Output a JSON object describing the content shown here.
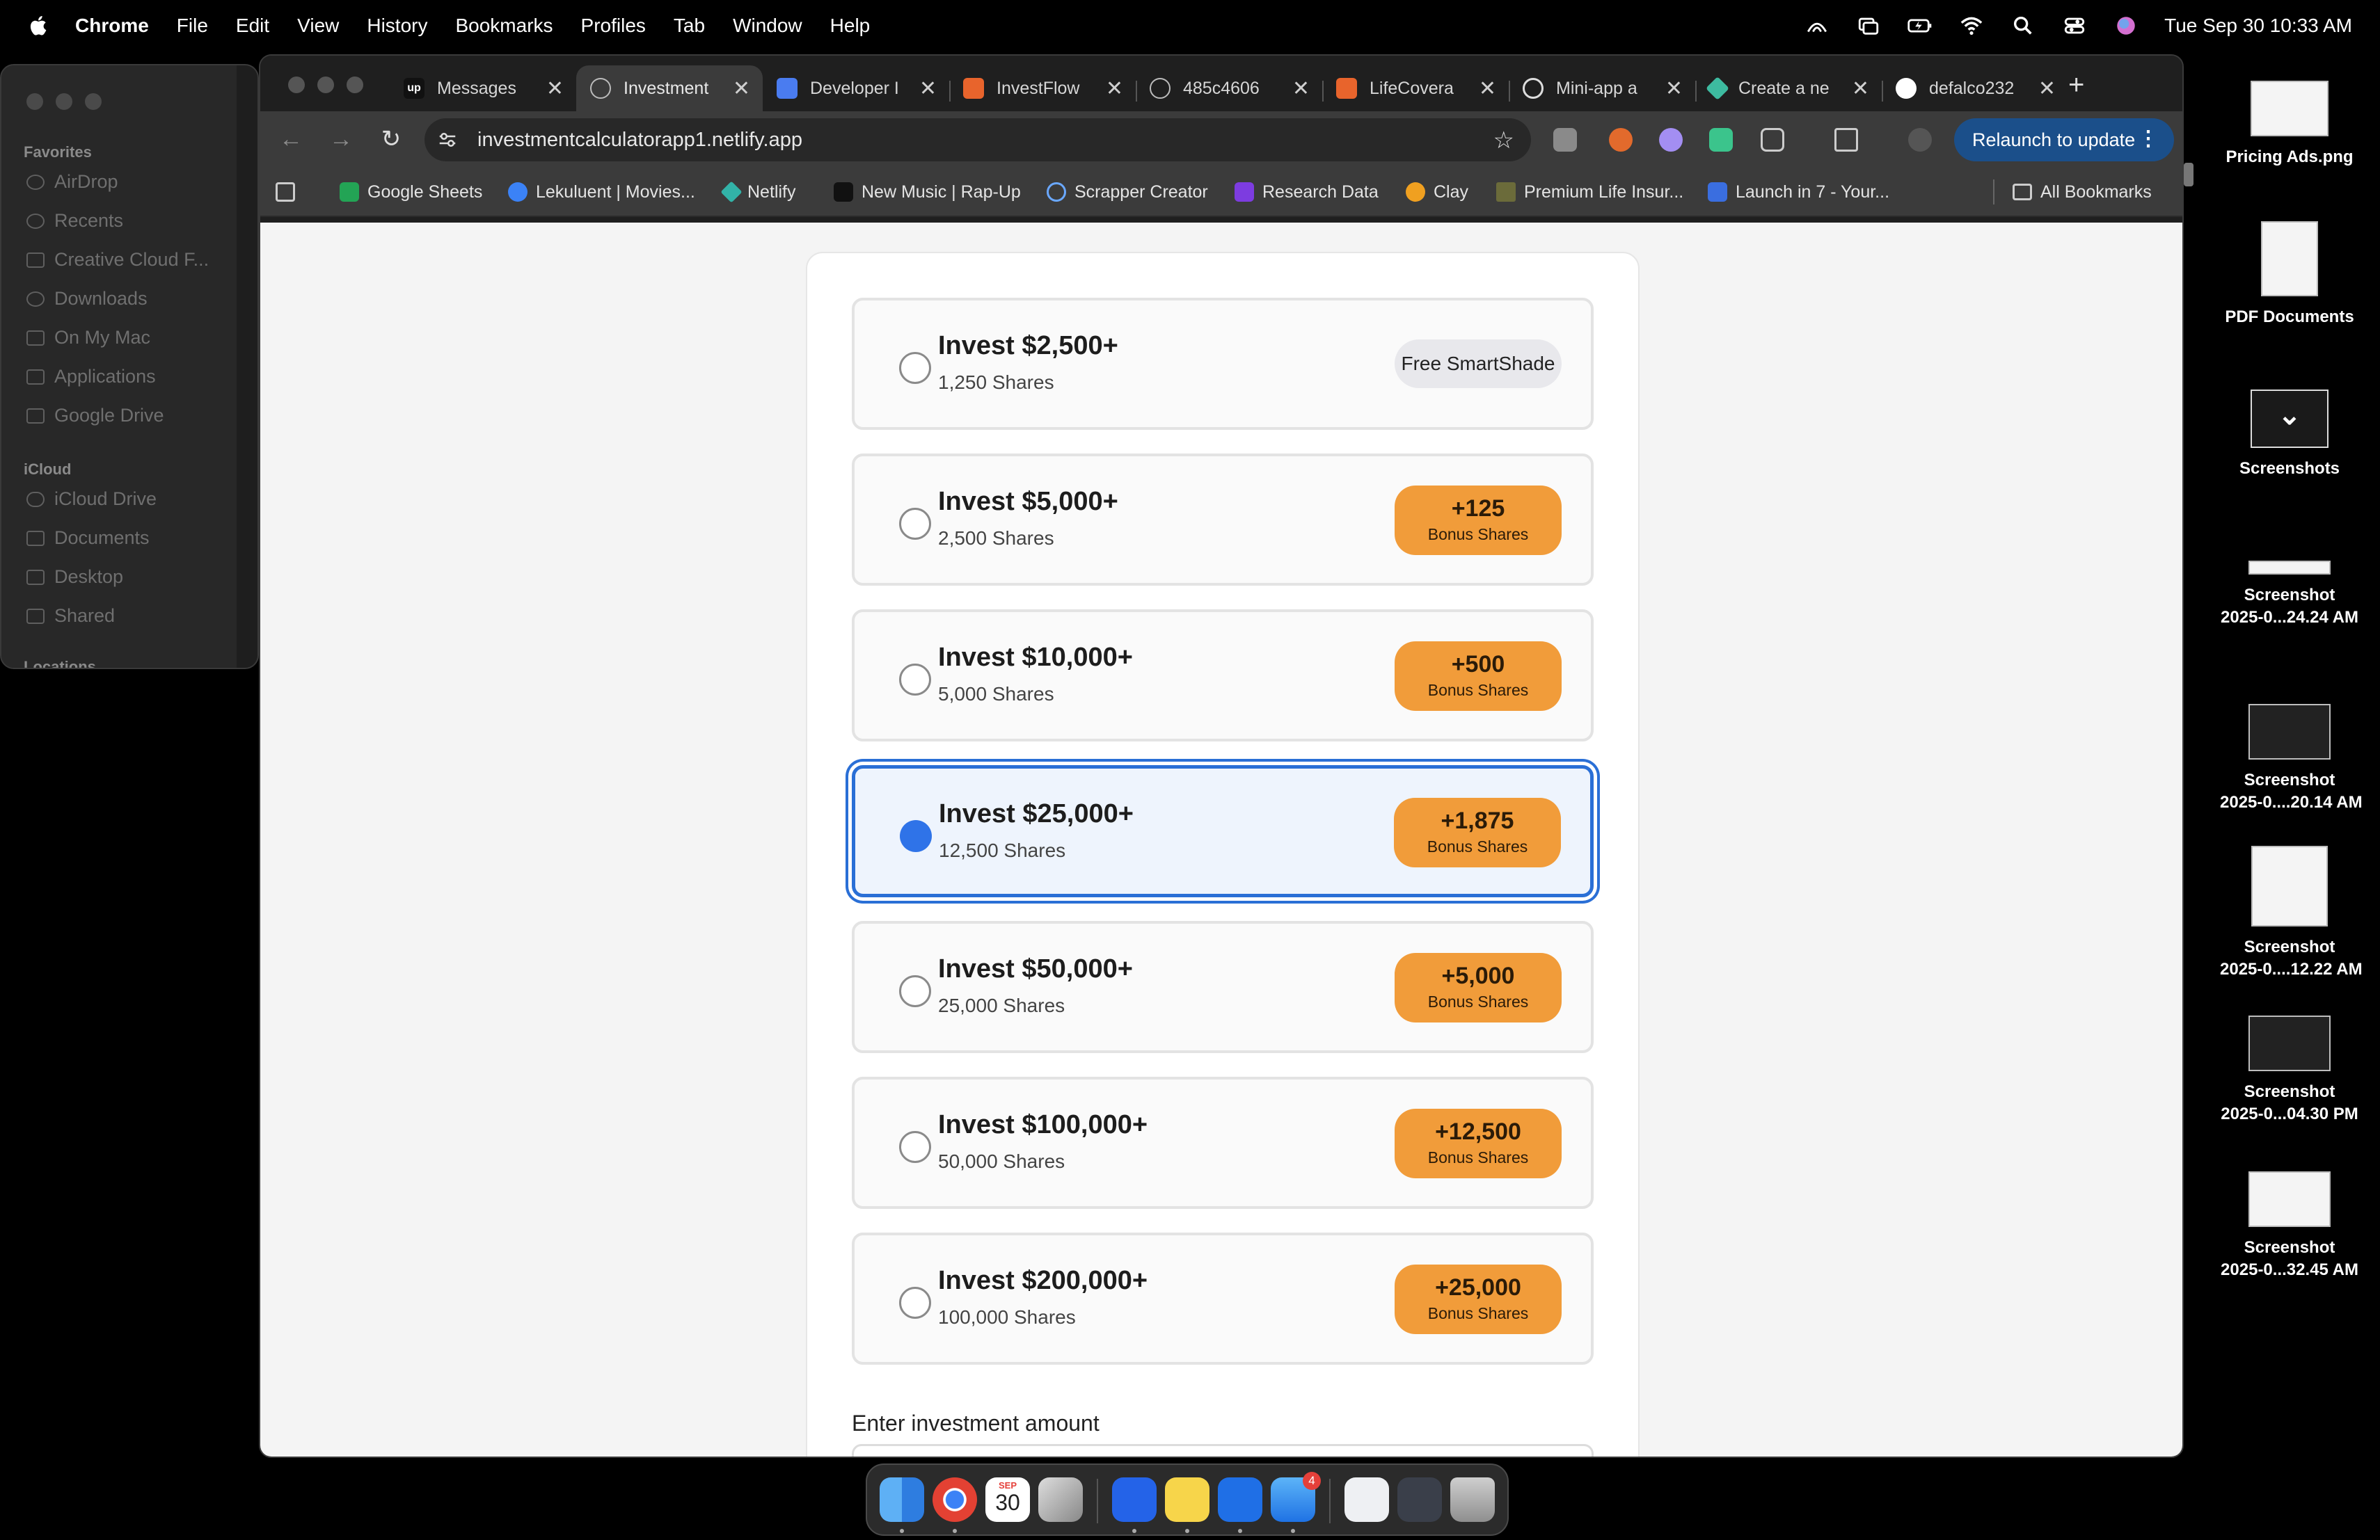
{
  "menubar": {
    "app_name": "Chrome",
    "menus": [
      "File",
      "Edit",
      "View",
      "History",
      "Bookmarks",
      "Profiles",
      "Tab",
      "Window",
      "Help"
    ],
    "clock": "Tue Sep 30  10:33 AM"
  },
  "finder": {
    "favorites_header": "Favorites",
    "favorites": [
      "AirDrop",
      "Recents",
      "Creative Cloud F...",
      "Downloads",
      "On My Mac",
      "Applications",
      "Google Drive"
    ],
    "icloud_header": "iCloud",
    "icloud": [
      "iCloud Drive",
      "Documents",
      "Desktop",
      "Shared"
    ],
    "locations_header": "Locations"
  },
  "chrome": {
    "tabs": [
      {
        "title": "Messages",
        "icon": "upwork-icon",
        "color": "#111111"
      },
      {
        "title": "Investment",
        "icon": "globe-icon",
        "color": "#777777"
      },
      {
        "title": "Developer I",
        "icon": "docs-icon",
        "color": "#4a7cf0"
      },
      {
        "title": "InvestFlow",
        "icon": "figma-like-icon",
        "color": "#e8642c"
      },
      {
        "title": "485c4606",
        "icon": "globe-icon",
        "color": "#777777"
      },
      {
        "title": "LifeCovera",
        "icon": "figma-like-icon",
        "color": "#e8642c"
      },
      {
        "title": "Mini-app a",
        "icon": "openai-icon",
        "color": "#dddddd"
      },
      {
        "title": "Create a ne",
        "icon": "diamond-icon",
        "color": "#3dbba0"
      },
      {
        "title": "defalco232",
        "icon": "github-icon",
        "color": "#ffffff"
      }
    ],
    "url": "investmentcalculatorapp1.netlify.app",
    "relaunch_label": "Relaunch to update",
    "bookmarks": [
      {
        "label": "Google Sheets",
        "color": "#23a455"
      },
      {
        "label": "Lekuluent | Movies...",
        "color": "#3b82f6"
      },
      {
        "label": "Netlify",
        "color": "#32b3a8"
      },
      {
        "label": "New Music | Rap-Up",
        "color": "#111111"
      },
      {
        "label": "Scrapper Creator",
        "color": "#6aa8ff"
      },
      {
        "label": "Research Data",
        "color": "#7d3ce0"
      },
      {
        "label": "Clay",
        "color": "#f0a020"
      },
      {
        "label": "Premium Life Insur...",
        "color": "#6b6b3a"
      },
      {
        "label": "Launch in 7 - Your...",
        "color": "#3a6ee0"
      }
    ],
    "all_bookmarks_label": "All Bookmarks"
  },
  "page": {
    "options": [
      {
        "amount": "Invest $2,500+",
        "shares": "1,250 Shares",
        "badge_main": "Free SmartShade",
        "badge_sub": "",
        "selected": false
      },
      {
        "amount": "Invest $5,000+",
        "shares": "2,500 Shares",
        "badge_main": "+125",
        "badge_sub": "Bonus Shares",
        "selected": false
      },
      {
        "amount": "Invest $10,000+",
        "shares": "5,000 Shares",
        "badge_main": "+500",
        "badge_sub": "Bonus Shares",
        "selected": false
      },
      {
        "amount": "Invest $25,000+",
        "shares": "12,500 Shares",
        "badge_main": "+1,875",
        "badge_sub": "Bonus Shares",
        "selected": true
      },
      {
        "amount": "Invest $50,000+",
        "shares": "25,000 Shares",
        "badge_main": "+5,000",
        "badge_sub": "Bonus Shares",
        "selected": false
      },
      {
        "amount": "Invest $100,000+",
        "shares": "50,000 Shares",
        "badge_main": "+12,500",
        "badge_sub": "Bonus Shares",
        "selected": false
      },
      {
        "amount": "Invest $200,000+",
        "shares": "100,000 Shares",
        "badge_main": "+25,000",
        "badge_sub": "Bonus Shares",
        "selected": false
      }
    ],
    "amount_label": "Enter investment amount",
    "accent_color": "#2f73e8",
    "badge_color": "#f19c3a"
  },
  "desktop": {
    "icons": [
      {
        "line1": "Pricing Ads.png",
        "line2": ""
      },
      {
        "line1": "PDF Documents",
        "line2": ""
      },
      {
        "line1": "Screenshots",
        "line2": ""
      },
      {
        "line1": "Screenshot",
        "line2": "2025-0...24.24 AM"
      },
      {
        "line1": "Screenshot",
        "line2": "2025-0....20.14 AM"
      },
      {
        "line1": "Screenshot",
        "line2": "2025-0....12.22 AM"
      },
      {
        "line1": "Screenshot",
        "line2": "2025-0...04.30 PM"
      },
      {
        "line1": "Screenshot",
        "line2": "2025-0...32.45 AM"
      }
    ]
  },
  "dock": {
    "calendar_month": "SEP",
    "calendar_day": "30",
    "mail_badge": "4"
  }
}
